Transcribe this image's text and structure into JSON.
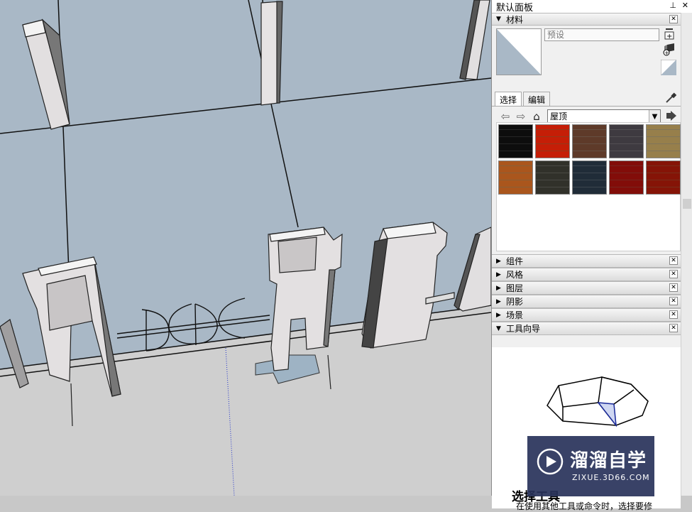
{
  "tray": {
    "title": "默认面板",
    "pin_icon": "pin-icon",
    "close_icon": "close-icon"
  },
  "materials": {
    "header": "材料",
    "name_placeholder": "预设",
    "tabs": [
      "选择",
      "编辑"
    ],
    "library": "屋顶",
    "textures": [
      {
        "name": "dark-slate-shingles",
        "color": "#3a3a3a"
      },
      {
        "name": "orange-scalloped-tiles",
        "color": "#e0582a"
      },
      {
        "name": "brown-wood-shakes",
        "color": "#9b7a66"
      },
      {
        "name": "grey-asphalt-shingles",
        "color": "#7e7a80"
      },
      {
        "name": "tan-wood-shingles",
        "color": "#c4b48a"
      },
      {
        "name": "tan-scalloped-tiles",
        "color": "#d09456"
      },
      {
        "name": "grey-flat-tiles",
        "color": "#707068"
      },
      {
        "name": "blue-grey-slate",
        "color": "#5a6a78"
      },
      {
        "name": "red-metal-panels",
        "color": "#b63a30"
      },
      {
        "name": "red-clay-barrel-tiles",
        "color": "#b8482a"
      }
    ]
  },
  "panels": [
    {
      "label": "组件",
      "expanded": false
    },
    {
      "label": "风格",
      "expanded": false
    },
    {
      "label": "图层",
      "expanded": false
    },
    {
      "label": "阴影",
      "expanded": false
    },
    {
      "label": "场景",
      "expanded": false
    },
    {
      "label": "工具向导",
      "expanded": true
    }
  ],
  "instructor": {
    "heading": "选择工具",
    "body": "在使用其他工具或命令时，选择要修"
  },
  "watermark": {
    "name": "溜溜自学",
    "url": "ZIXUE.3D66.COM"
  },
  "colors": {
    "sky_plane": "#a9b8c6",
    "ground": "#cfcfcf",
    "selection_blue": "#9eb3c4"
  }
}
